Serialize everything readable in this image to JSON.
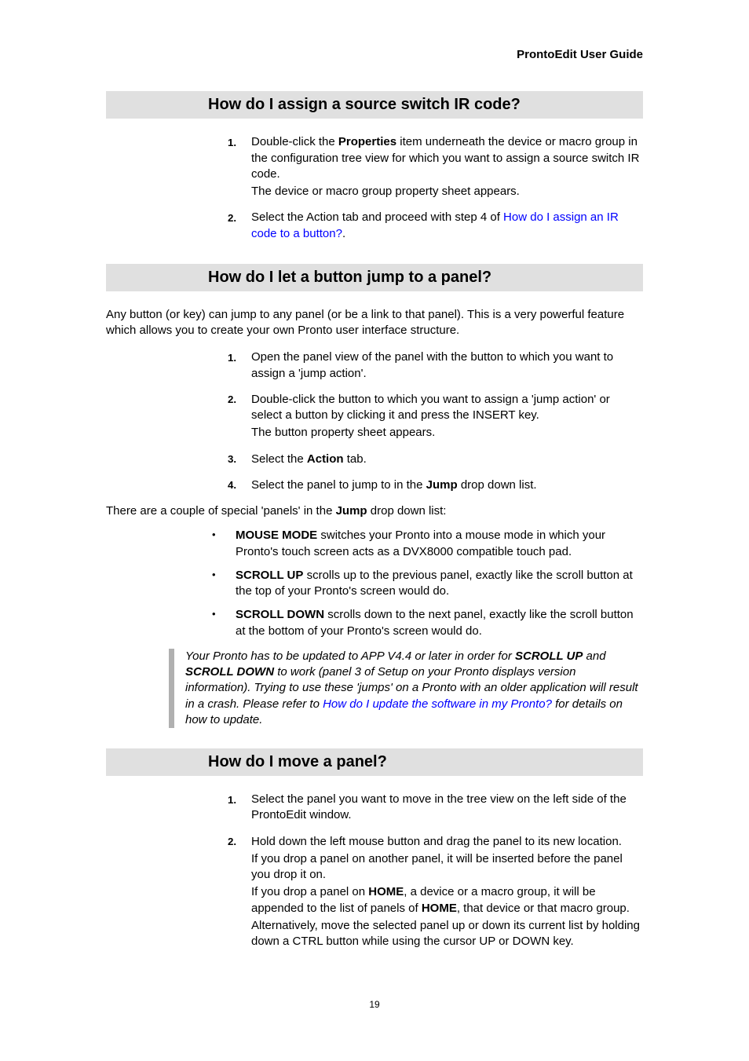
{
  "header": {
    "title": "ProntoEdit User Guide"
  },
  "sections": {
    "assign_ir": {
      "heading": "How do I assign a source switch IR code?",
      "steps": [
        {
          "num": "1.",
          "lines": [
            {
              "plain_pre": "Double-click the ",
              "bold": "Properties",
              "plain_post": " item underneath the device or macro group in the configuration tree view for which you want to assign a source switch IR code."
            },
            {
              "plain": "The device or macro group property sheet appears."
            }
          ]
        },
        {
          "num": "2.",
          "lines": [
            {
              "plain_pre": "Select the Action tab and proceed with step 4 of ",
              "link": "How do I assign an IR code to a button?",
              "plain_post": "."
            }
          ]
        }
      ]
    },
    "jump_panel": {
      "heading": "How do I let a button jump to a panel?",
      "intro": "Any button (or key) can jump to any panel (or be a link to that panel). This is a very powerful feature which allows you to create your own Pronto user interface structure.",
      "steps": [
        {
          "num": "1.",
          "lines": [
            {
              "plain": "Open the panel view of the panel with the button to which you want to assign a 'jump action'."
            }
          ]
        },
        {
          "num": "2.",
          "lines": [
            {
              "plain": "Double-click the button to which you want to assign a 'jump action' or select a button by clicking it and press the INSERT key."
            },
            {
              "plain": "The button property sheet appears."
            }
          ]
        },
        {
          "num": "3.",
          "lines": [
            {
              "plain_pre": "Select the ",
              "bold": "Action",
              "plain_post": " tab."
            }
          ]
        },
        {
          "num": "4.",
          "lines": [
            {
              "plain_pre": "Select the panel to jump to in the ",
              "bold": "Jump",
              "plain_post": " drop down list."
            }
          ]
        }
      ],
      "mid_para_pre": "There are a couple of special 'panels' in the ",
      "mid_para_bold": "Jump",
      "mid_para_post": " drop down list:",
      "bullets": [
        {
          "bold": "MOUSE MODE",
          "rest": " switches your Pronto into a mouse mode in which your Pronto's touch screen acts as a DVX8000 compatible touch pad."
        },
        {
          "bold": "SCROLL UP",
          "rest": " scrolls up to the previous panel, exactly like the scroll button at the top of your Pronto's screen would do."
        },
        {
          "bold": "SCROLL DOWN",
          "rest": " scrolls down to the next panel, exactly like the scroll button at the bottom of your Pronto's screen would do."
        }
      ],
      "note": {
        "pre": "Your Pronto has to be updated to APP V4.4 or later in order for ",
        "b1": "SCROLL UP",
        "mid1": " and ",
        "b2": "SCROLL DOWN",
        "mid2": " to work (panel 3 of Setup on your Pronto displays version information). Trying to use these 'jumps' on a Pronto with an older application will result in a crash. Please refer to ",
        "link": "How do I update the software in my Pronto?",
        "post": " for details on how to update."
      }
    },
    "move_panel": {
      "heading": "How do I move a panel?",
      "steps": [
        {
          "num": "1.",
          "lines": [
            {
              "plain": "Select the panel you want to move in the tree view on the left side of the ProntoEdit window."
            }
          ]
        },
        {
          "num": "2.",
          "lines": [
            {
              "plain": "Hold down the left mouse button and drag the panel to its new location."
            },
            {
              "plain": "If you drop a panel on another panel, it will be inserted before the panel you drop it on."
            },
            {
              "plain_pre": "If you drop a panel on ",
              "bold": "HOME",
              "plain_mid": ", a device or a macro group, it will be appended to the list of panels of ",
              "bold2": "HOME",
              "plain_post": ", that device or that macro group."
            },
            {
              "plain": "Alternatively, move the selected panel up or down its current list by holding down a CTRL button while using the cursor UP or DOWN key."
            }
          ]
        }
      ]
    }
  },
  "page_number": "19"
}
